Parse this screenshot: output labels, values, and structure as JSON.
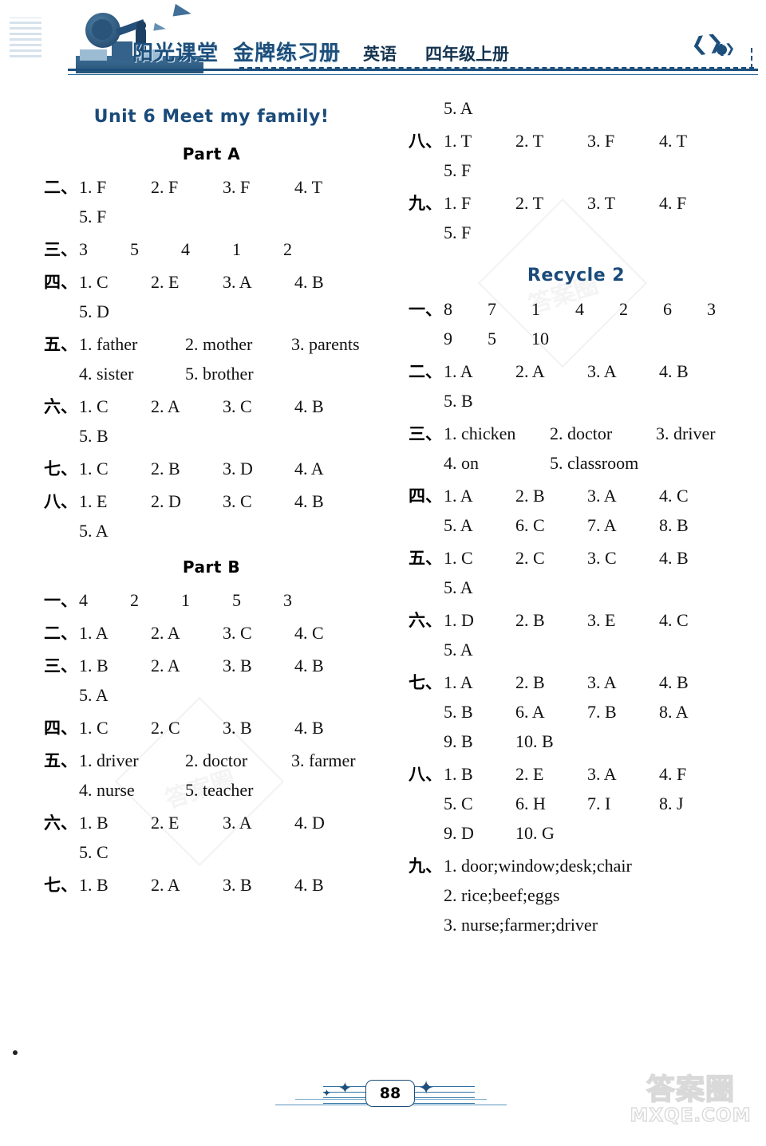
{
  "header": {
    "brand_part1": "阳光课堂",
    "brand_part2": "金牌练习册",
    "subject": "英语",
    "grade": "四年级上册"
  },
  "footer": {
    "page_number": "88",
    "watermark_cn": "答案圈",
    "watermark_url": "MXQE.COM",
    "watermark_ghost": "答案圈"
  },
  "left_column": {
    "unit_title": "Unit 6   Meet my family!",
    "part_a_title": "Part A",
    "part_b_title": "Part B",
    "part_a": [
      {
        "cn": "二、",
        "items": [
          "1. F",
          "2. F",
          "3. F",
          "4. T"
        ],
        "cols": "w4"
      },
      {
        "cn": "",
        "items": [
          "5. F"
        ],
        "cols": "w4",
        "cont": true
      },
      {
        "cn": "三、",
        "items": [
          "3",
          "5",
          "4",
          "1",
          "2"
        ],
        "cols": "w5"
      },
      {
        "cn": "四、",
        "items": [
          "1. C",
          "2. E",
          "3. A",
          "4. B"
        ],
        "cols": "w4"
      },
      {
        "cn": "",
        "items": [
          "5. D"
        ],
        "cols": "w4",
        "cont": true
      },
      {
        "cn": "五、",
        "items": [
          "1. father",
          "2. mother",
          "3. parents"
        ],
        "cols": "w3"
      },
      {
        "cn": "",
        "items": [
          "4. sister",
          "5. brother"
        ],
        "cols": "w3",
        "cont": true
      },
      {
        "cn": "六、",
        "items": [
          "1. C",
          "2. A",
          "3. C",
          "4. B"
        ],
        "cols": "w4"
      },
      {
        "cn": "",
        "items": [
          "5. B"
        ],
        "cols": "w4",
        "cont": true
      },
      {
        "cn": "七、",
        "items": [
          "1. C",
          "2. B",
          "3. D",
          "4. A"
        ],
        "cols": "w4"
      },
      {
        "cn": "八、",
        "items": [
          "1. E",
          "2. D",
          "3. C",
          "4. B"
        ],
        "cols": "w4"
      },
      {
        "cn": "",
        "items": [
          "5. A"
        ],
        "cols": "w4",
        "cont": true
      }
    ],
    "part_b": [
      {
        "cn": "一、",
        "items": [
          "4",
          "2",
          "1",
          "5",
          "3"
        ],
        "cols": "w5"
      },
      {
        "cn": "二、",
        "items": [
          "1. A",
          "2. A",
          "3. C",
          "4. C"
        ],
        "cols": "w4"
      },
      {
        "cn": "三、",
        "items": [
          "1. B",
          "2. A",
          "3. B",
          "4. B"
        ],
        "cols": "w4"
      },
      {
        "cn": "",
        "items": [
          "5. A"
        ],
        "cols": "w4",
        "cont": true
      },
      {
        "cn": "四、",
        "items": [
          "1. C",
          "2. C",
          "3. B",
          "4. B"
        ],
        "cols": "w4"
      },
      {
        "cn": "五、",
        "items": [
          "1. driver",
          "2. doctor",
          "3. farmer"
        ],
        "cols": "w3"
      },
      {
        "cn": "",
        "items": [
          "4. nurse",
          "5. teacher"
        ],
        "cols": "w3",
        "cont": true
      },
      {
        "cn": "六、",
        "items": [
          "1. B",
          "2. E",
          "3. A",
          "4. D"
        ],
        "cols": "w4"
      },
      {
        "cn": "",
        "items": [
          "5. C"
        ],
        "cols": "w4",
        "cont": true
      },
      {
        "cn": "七、",
        "items": [
          "1. B",
          "2. A",
          "3. B",
          "4. B"
        ],
        "cols": "w4"
      }
    ]
  },
  "right_column": {
    "recycle_title": "Recycle 2",
    "part_b_tail": [
      {
        "cn": "",
        "items": [
          "5. A"
        ],
        "cols": "w4",
        "cont": true
      },
      {
        "cn": "八、",
        "items": [
          "1. T",
          "2. T",
          "3. F",
          "4. T"
        ],
        "cols": "w4"
      },
      {
        "cn": "",
        "items": [
          "5. F"
        ],
        "cols": "w4",
        "cont": true
      },
      {
        "cn": "九、",
        "items": [
          "1. F",
          "2. T",
          "3. T",
          "4. F"
        ],
        "cols": "w4"
      },
      {
        "cn": "",
        "items": [
          "5. F"
        ],
        "cols": "w4",
        "cont": true
      }
    ],
    "recycle": [
      {
        "cn": "一、",
        "items": [
          "8",
          "7",
          "1",
          "4",
          "2",
          "6",
          "3"
        ],
        "cols": "w7"
      },
      {
        "cn": "",
        "items": [
          "9",
          "5",
          "10"
        ],
        "cols": "w7",
        "cont": true
      },
      {
        "cn": "二、",
        "items": [
          "1. A",
          "2. A",
          "3. A",
          "4. B"
        ],
        "cols": "w4"
      },
      {
        "cn": "",
        "items": [
          "5. B"
        ],
        "cols": "w4",
        "cont": true
      },
      {
        "cn": "三、",
        "items": [
          "1. chicken",
          "2. doctor",
          "3. driver"
        ],
        "cols": "w3"
      },
      {
        "cn": "",
        "items": [
          "4. on",
          "5. classroom"
        ],
        "cols": "w3",
        "cont": true
      },
      {
        "cn": "四、",
        "items": [
          "1. A",
          "2. B",
          "3. A",
          "4. C"
        ],
        "cols": "w4"
      },
      {
        "cn": "",
        "items": [
          "5. A",
          "6. C",
          "7. A",
          "8. B"
        ],
        "cols": "w4",
        "cont": true
      },
      {
        "cn": "五、",
        "items": [
          "1. C",
          "2. C",
          "3. C",
          "4. B"
        ],
        "cols": "w4"
      },
      {
        "cn": "",
        "items": [
          "5. A"
        ],
        "cols": "w4",
        "cont": true
      },
      {
        "cn": "六、",
        "items": [
          "1. D",
          "2. B",
          "3. E",
          "4. C"
        ],
        "cols": "w4"
      },
      {
        "cn": "",
        "items": [
          "5. A"
        ],
        "cols": "w4",
        "cont": true
      },
      {
        "cn": "七、",
        "items": [
          "1. A",
          "2. B",
          "3. A",
          "4. B"
        ],
        "cols": "w4"
      },
      {
        "cn": "",
        "items": [
          "5. B",
          "6. A",
          "7. B",
          "8. A"
        ],
        "cols": "w4",
        "cont": true
      },
      {
        "cn": "",
        "items": [
          "9. B",
          "10. B"
        ],
        "cols": "w4",
        "cont": true
      },
      {
        "cn": "八、",
        "items": [
          "1. B",
          "2. E",
          "3. A",
          "4. F"
        ],
        "cols": "w4"
      },
      {
        "cn": "",
        "items": [
          "5. C",
          "6. H",
          "7. I",
          "8. J"
        ],
        "cols": "w4",
        "cont": true
      },
      {
        "cn": "",
        "items": [
          "9. D",
          "10. G"
        ],
        "cols": "w4",
        "cont": true
      },
      {
        "cn": "九、",
        "items": [
          "1. door;window;desk;chair"
        ],
        "cols": "w1"
      },
      {
        "cn": "",
        "items": [
          "2. rice;beef;eggs"
        ],
        "cols": "w1",
        "cont": true
      },
      {
        "cn": "",
        "items": [
          "3. nurse;farmer;driver"
        ],
        "cols": "w1",
        "cont": true
      }
    ]
  },
  "colors": {
    "accent_blue": "#1d4f7c",
    "title_blue": "#1a4b7a",
    "text_black": "#111111"
  }
}
